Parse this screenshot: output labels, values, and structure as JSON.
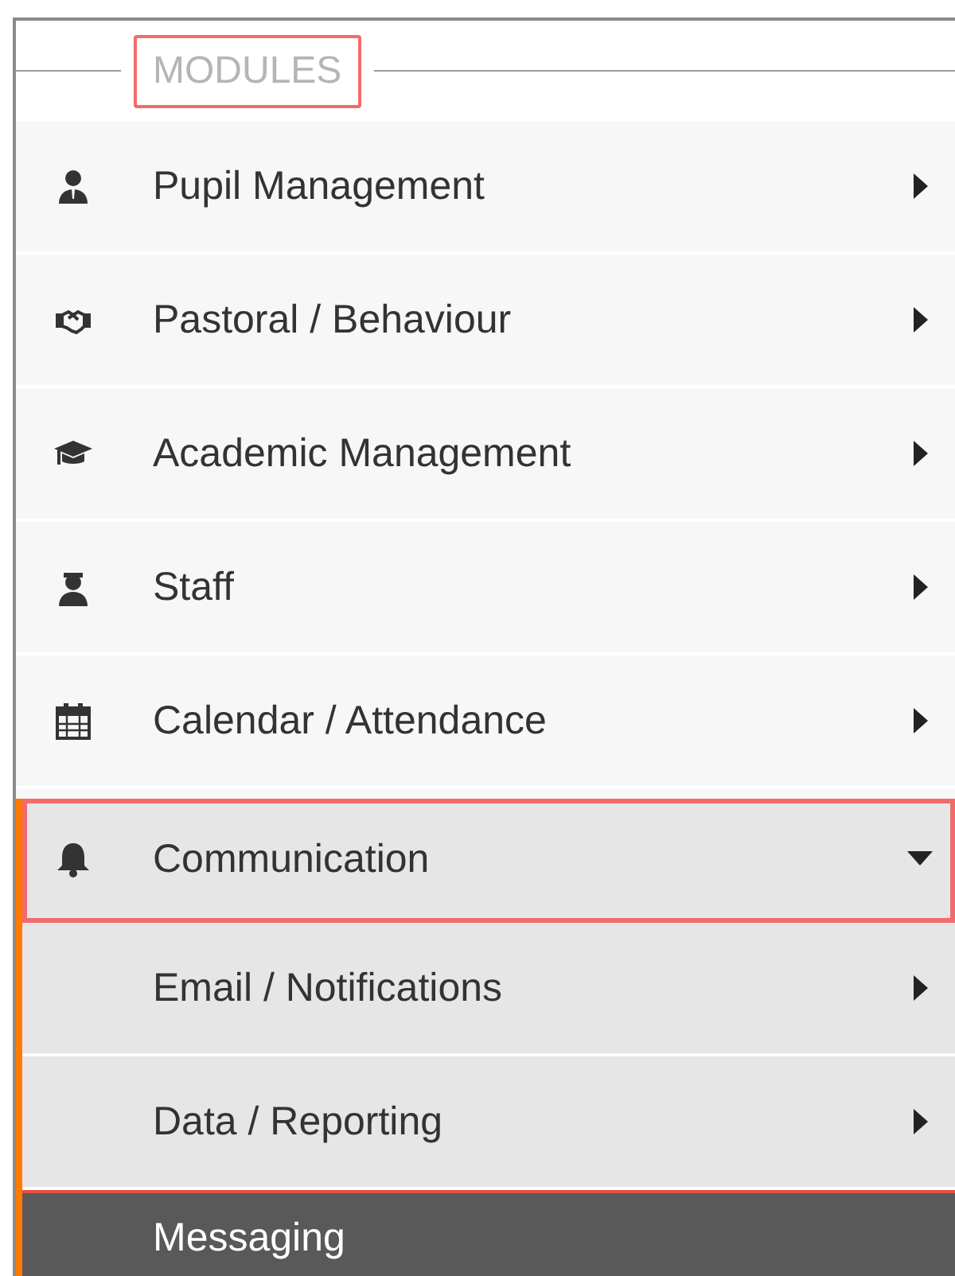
{
  "heading": {
    "label": "MODULES",
    "highlighted": true
  },
  "modules": [
    {
      "label": "Pupil Management",
      "expanded": false,
      "highlighted": false
    },
    {
      "label": "Pastoral / Behaviour",
      "expanded": false,
      "highlighted": false
    },
    {
      "label": "Academic Management",
      "expanded": false,
      "highlighted": false
    },
    {
      "label": "Staff",
      "expanded": false,
      "highlighted": false
    },
    {
      "label": "Calendar / Attendance",
      "expanded": false,
      "highlighted": false
    },
    {
      "label": "Communication",
      "expanded": true,
      "highlighted": true,
      "children": [
        {
          "label": "Email / Notifications",
          "submenu": true,
          "selected": false
        },
        {
          "label": "Data / Reporting",
          "submenu": true,
          "selected": false
        },
        {
          "label": "Messaging",
          "submenu": false,
          "selected": true
        }
      ]
    }
  ]
}
